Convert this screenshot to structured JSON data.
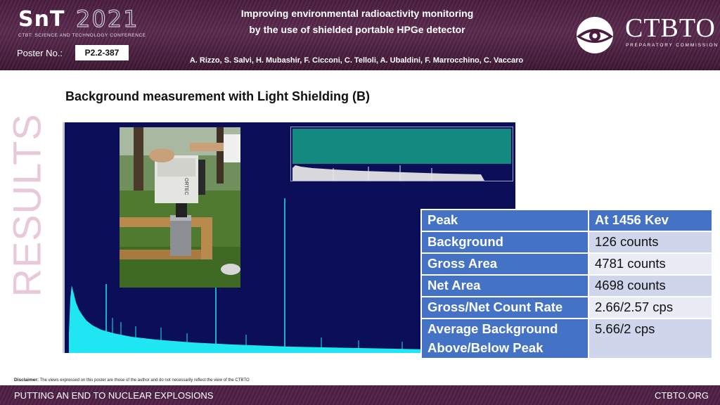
{
  "header": {
    "logo_snt": "SnT",
    "logo_year": "2021",
    "logo_subtitle": "CTBT: SCIENCE AND TECHNOLOGY CONFERENCE",
    "poster_label": "Poster No.:",
    "poster_number": "P2.2-387",
    "title_line1": "Improving environmental radioactivity monitoring",
    "title_line2": "by the use of shielded portable HPGe detector",
    "authors": "A. Rizzo, S. Salvi, H. Mubashir, F. Cicconi, C. Telloli, A. Ubaldini, F. Marrocchino, C. Vaccaro",
    "org_name": "CTBTO",
    "org_subtitle": "PREPARATORY COMMISSION"
  },
  "side_label": "RESULTS",
  "section_title": "Background measurement with Light Shielding (B)",
  "table": {
    "rows": [
      {
        "key": "Peak",
        "value": "At 1456 Kev"
      },
      {
        "key": "Background",
        "value": "126 counts"
      },
      {
        "key": "Gross Area",
        "value": "4781 counts"
      },
      {
        "key": "Net Area",
        "value": "4698 counts"
      },
      {
        "key": "Gross/Net Count Rate",
        "value": "2.66/2.57 cps"
      },
      {
        "key": "Average Background",
        "key2": "Above/Below Peak",
        "value": "5.66/2 cps"
      }
    ]
  },
  "detector_label": "ORTEC",
  "disclaimer_label": "Disclaimer:",
  "disclaimer_text": "The views expressed on this poster are those of the author and do not necessarily reflect the view of the CTBTO",
  "footer": {
    "left": "PUTTING AN END TO NUCLEAR EXPLOSIONS",
    "right": "CTBTO.ORG"
  },
  "colors": {
    "header_bg": "#4a1d3f",
    "table_header": "#4472c4",
    "table_row_a": "#cfd5ea",
    "table_row_b": "#e9ebf5",
    "spectrum_bg": "#0a0f58",
    "spectrum_trace": "#1fe6f2",
    "side_label": "#e8c9da"
  }
}
